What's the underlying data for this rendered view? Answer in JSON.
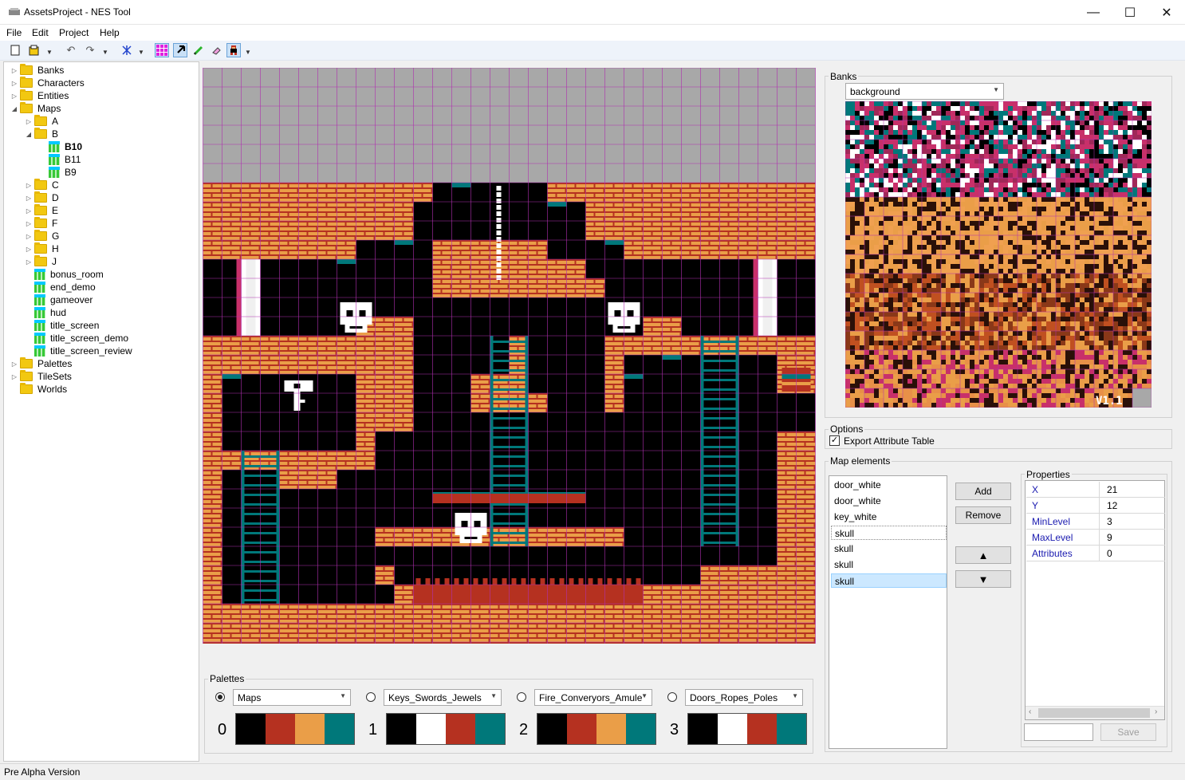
{
  "window": {
    "title": "AssetsProject - NES Tool",
    "minimize_glyph": "—",
    "maximize_glyph": "☐",
    "close_glyph": "✕"
  },
  "menu": [
    "File",
    "Edit",
    "Project",
    "Help"
  ],
  "toolbar": {
    "icons": [
      "new-file-icon",
      "open-folder-icon",
      "undo-icon",
      "redo-icon",
      "grid-toggle-icon",
      "select-arrow-icon",
      "pencil-icon",
      "eraser-icon",
      "sprite-icon"
    ],
    "active_icons": [
      "grid-toggle-icon",
      "select-arrow-icon",
      "sprite-icon"
    ]
  },
  "tree": {
    "nodes": [
      {
        "label": "Banks",
        "type": "folder",
        "level": 0,
        "expander": "closed"
      },
      {
        "label": "Characters",
        "type": "folder",
        "level": 0,
        "expander": "closed"
      },
      {
        "label": "Entities",
        "type": "folder",
        "level": 0,
        "expander": "closed"
      },
      {
        "label": "Maps",
        "type": "folder",
        "level": 0,
        "expander": "open"
      },
      {
        "label": "A",
        "type": "folder",
        "level": 1,
        "expander": "closed"
      },
      {
        "label": "B",
        "type": "folder",
        "level": 1,
        "expander": "open"
      },
      {
        "label": "B10",
        "type": "map",
        "level": 2,
        "expander": "none",
        "bold": true
      },
      {
        "label": "B11",
        "type": "map",
        "level": 2,
        "expander": "none"
      },
      {
        "label": "B9",
        "type": "map",
        "level": 2,
        "expander": "none"
      },
      {
        "label": "C",
        "type": "folder",
        "level": 1,
        "expander": "closed"
      },
      {
        "label": "D",
        "type": "folder",
        "level": 1,
        "expander": "closed"
      },
      {
        "label": "E",
        "type": "folder",
        "level": 1,
        "expander": "closed"
      },
      {
        "label": "F",
        "type": "folder",
        "level": 1,
        "expander": "closed"
      },
      {
        "label": "G",
        "type": "folder",
        "level": 1,
        "expander": "closed"
      },
      {
        "label": "H",
        "type": "folder",
        "level": 1,
        "expander": "closed"
      },
      {
        "label": "J",
        "type": "folder",
        "level": 1,
        "expander": "closed"
      },
      {
        "label": "bonus_room",
        "type": "map",
        "level": 1,
        "expander": "none"
      },
      {
        "label": "end_demo",
        "type": "map",
        "level": 1,
        "expander": "none"
      },
      {
        "label": "gameover",
        "type": "map",
        "level": 1,
        "expander": "none"
      },
      {
        "label": "hud",
        "type": "map",
        "level": 1,
        "expander": "none"
      },
      {
        "label": "title_screen",
        "type": "map",
        "level": 1,
        "expander": "none"
      },
      {
        "label": "title_screen_demo",
        "type": "map",
        "level": 1,
        "expander": "none"
      },
      {
        "label": "title_screen_review",
        "type": "map",
        "level": 1,
        "expander": "none"
      },
      {
        "label": "Palettes",
        "type": "folder",
        "level": 0,
        "expander": "closed"
      },
      {
        "label": "TileSets",
        "type": "folder",
        "level": 0,
        "expander": "closed"
      },
      {
        "label": "Worlds",
        "type": "folder",
        "level": 0,
        "expander": "none"
      }
    ]
  },
  "palettes": {
    "title": "Palettes",
    "items": [
      {
        "number": "0",
        "name": "Maps",
        "selected": true,
        "colors": [
          "#000000",
          "#b53120",
          "#ea9e48",
          "#00787a"
        ]
      },
      {
        "number": "1",
        "name": "Keys_Swords_Jewels",
        "selected": false,
        "colors": [
          "#000000",
          "#ffffff",
          "#b53120",
          "#00787a"
        ]
      },
      {
        "number": "2",
        "name": "Fire_Converyors_Amule",
        "selected": false,
        "colors": [
          "#000000",
          "#b53120",
          "#ea9e48",
          "#00787a"
        ]
      },
      {
        "number": "3",
        "name": "Doors_Ropes_Poles",
        "selected": false,
        "colors": [
          "#000000",
          "#ffffff",
          "#b53120",
          "#00787a"
        ]
      }
    ]
  },
  "banks": {
    "title": "Banks",
    "selected": "background",
    "version_text": "V1.1"
  },
  "options": {
    "title": "Options",
    "export_attribute_table_label": "Export Attribute Table",
    "export_attribute_table_checked": true
  },
  "map_elements": {
    "title": "Map elements",
    "items": [
      "door_white",
      "door_white",
      "key_white",
      "skull",
      "skull",
      "skull",
      "skull"
    ],
    "selected_index": 6,
    "focused_index": 3,
    "add_label": "Add",
    "remove_label": "Remove",
    "up_glyph": "▲",
    "down_glyph": "▼"
  },
  "properties": {
    "title": "Properties",
    "rows": [
      {
        "key": "X",
        "value": "21"
      },
      {
        "key": "Y",
        "value": "12"
      },
      {
        "key": "MinLevel",
        "value": "3"
      },
      {
        "key": "MaxLevel",
        "value": "9"
      },
      {
        "key": "Attributes",
        "value": "0"
      }
    ],
    "save_label": "Save",
    "input_value": ""
  },
  "status": {
    "text": "Pre Alpha Version"
  },
  "colors": {
    "black": "#000000",
    "brick": "#b53120",
    "orange": "#ea9e48",
    "teal": "#00787a",
    "white": "#ffffff",
    "magenta_grid": "#b030b0",
    "sky": "#a8a8a8",
    "pink": "#c8306a"
  }
}
